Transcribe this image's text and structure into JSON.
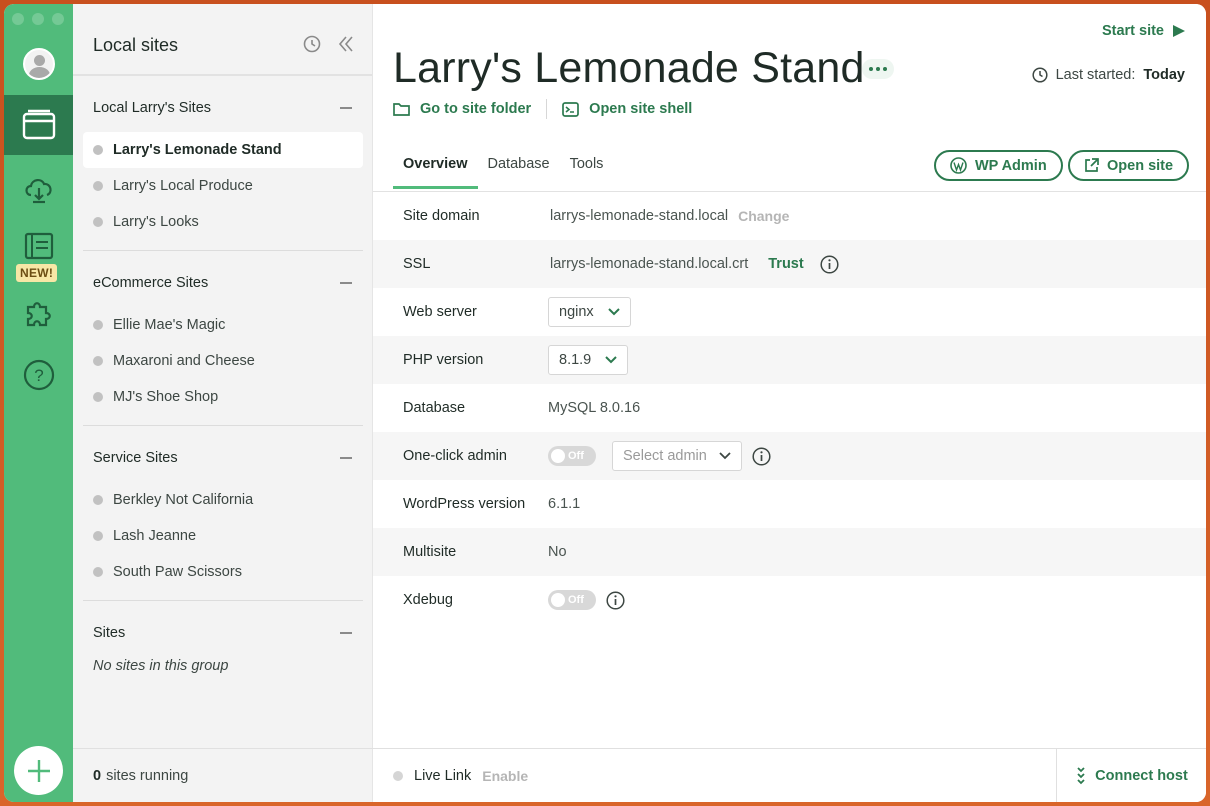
{
  "rail": {
    "new_badge": "NEW!",
    "items": [
      {
        "icon": "avatar-icon"
      },
      {
        "icon": "sites-icon",
        "active": true
      },
      {
        "icon": "cloud-icon"
      },
      {
        "icon": "blueprint-icon"
      },
      {
        "icon": "addons-puzzle-icon"
      },
      {
        "icon": "help-icon"
      },
      {
        "icon": "add-icon"
      }
    ]
  },
  "sidebar": {
    "title": "Local sites",
    "groups": [
      {
        "title": "Local Larry's Sites",
        "sites": [
          "Larry's Lemonade Stand",
          "Larry's Local Produce",
          "Larry's Looks"
        ]
      },
      {
        "title": "eCommerce Sites",
        "sites": [
          "Ellie Mae's Magic",
          "Maxaroni and Cheese",
          "MJ's Shoe Shop"
        ]
      },
      {
        "title": "Service Sites",
        "sites": [
          "Berkley Not California",
          "Lash Jeanne",
          "South Paw Scissors"
        ]
      },
      {
        "title": "Sites",
        "empty_text": "No sites in this group"
      }
    ],
    "footer": {
      "count": "0",
      "text": "sites running"
    }
  },
  "main": {
    "site_title": "Larry's Lemonade Stand",
    "start_site": "Start site",
    "last_started_label": "Last started:",
    "last_started_value": "Today",
    "go_to_folder": "Go to site folder",
    "open_shell": "Open site shell",
    "tabs": [
      "Overview",
      "Database",
      "Tools"
    ],
    "wp_admin": "WP Admin",
    "open_site": "Open site",
    "rows": {
      "site_domain": {
        "label": "Site domain",
        "value": "larrys-lemonade-stand.local",
        "action": "Change"
      },
      "ssl": {
        "label": "SSL",
        "value": "larrys-lemonade-stand.local.crt",
        "action": "Trust"
      },
      "web_server": {
        "label": "Web server",
        "value": "nginx"
      },
      "php_version": {
        "label": "PHP version",
        "value": "8.1.9"
      },
      "database": {
        "label": "Database",
        "value": "MySQL 8.0.16"
      },
      "one_click_admin": {
        "label": "One-click admin",
        "toggle": "Off",
        "placeholder": "Select admin"
      },
      "wordpress_version": {
        "label": "WordPress version",
        "value": "6.1.1"
      },
      "multisite": {
        "label": "Multisite",
        "value": "No"
      },
      "xdebug": {
        "label": "Xdebug",
        "toggle": "Off"
      }
    },
    "footer": {
      "live_link": "Live Link",
      "enable": "Enable",
      "connect_host": "Connect host"
    }
  },
  "colors": {
    "rail": "#51bb7b",
    "rail_active": "#2c7a4f",
    "accent_text": "#2c7a4f"
  }
}
